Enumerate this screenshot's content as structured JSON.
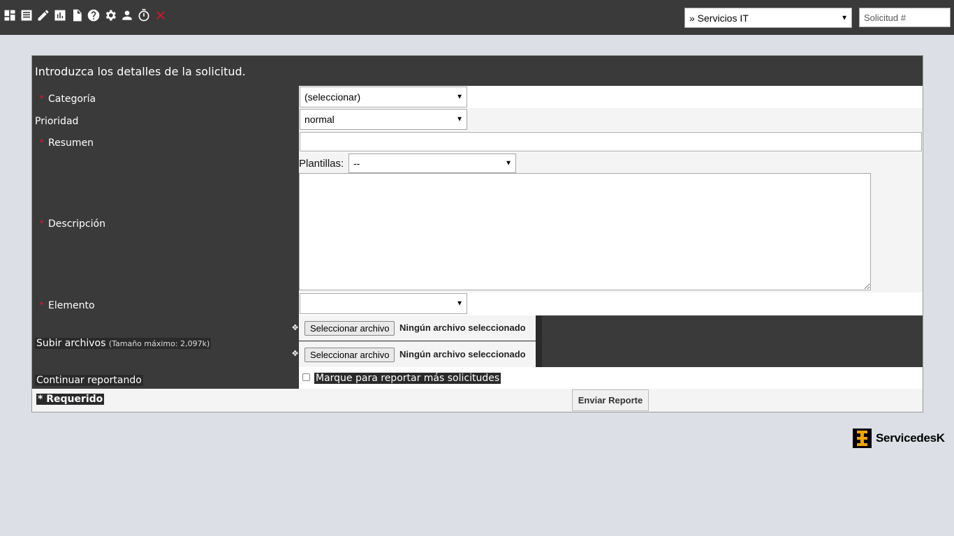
{
  "toolbar": {
    "icons": [
      "dashboard-icon",
      "list-icon",
      "edit-icon",
      "chart-icon",
      "document-icon",
      "help-icon",
      "gear-icon",
      "user-icon",
      "timer-icon",
      "close-icon"
    ],
    "project_select": "» Servicios IT",
    "search_placeholder": "Solicitud #"
  },
  "form": {
    "header": "Introduzca los detalles de la solicitud.",
    "required_mark": "*",
    "category_label": "Categoría",
    "category_value": "(seleccionar)",
    "priority_label": "Prioridad",
    "priority_value": "normal",
    "summary_label": "Resumen",
    "templates_label": "Plantillas:",
    "templates_value": "--",
    "description_label": "Descripción",
    "element_label": "Elemento",
    "element_value": "",
    "upload_label": "Subir archivos",
    "upload_hint": "(Tamaño máximo: 2,097k)",
    "file_button": "Seleccionar archivo",
    "file_none": "Ningún archivo seleccionado",
    "continue_label": "Continuar reportando",
    "continue_check_label": "Marque para reportar más solicitudes",
    "required_note": "* Requerido",
    "submit": "Enviar Reporte"
  },
  "brand": {
    "logo_text": "ServicedesK",
    "accent": "#f0a500",
    "required_color": "#e8102a"
  }
}
